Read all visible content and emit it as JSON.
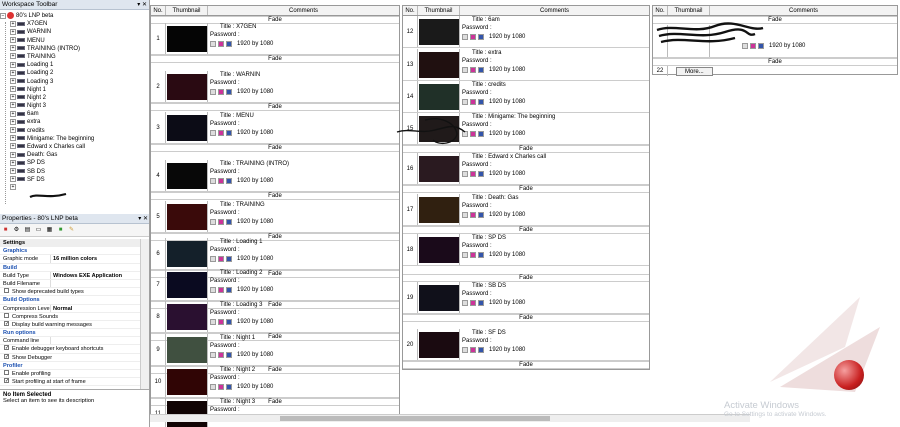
{
  "workspace": {
    "title": "Workspace Toolbar",
    "root": "80's LNP beta",
    "items": [
      "X7GEN",
      "WARNIN",
      "MENU",
      "TRAINING (INTRO)",
      "TRAINING",
      "Loading 1",
      "Loading 2",
      "Loading 3",
      "Night 1",
      "Night 2",
      "Night 3",
      "6am",
      "extra",
      "credits",
      "Minigame: The beginning",
      "Edward x Charles call",
      "Death: Gas",
      "SP DS",
      "SB DS",
      "SF DS"
    ]
  },
  "properties": {
    "title": "Properties - 80's LNP beta",
    "tab": "Settings",
    "sections": {
      "graphics": "Graphics",
      "build": "Build",
      "build_options": "Build Options",
      "run_options": "Run options",
      "profiler": "Profiler"
    },
    "graphic_mode_label": "Graphic mode",
    "graphic_mode_value": "16 million colors",
    "build_type_label": "Build Type",
    "build_type_value": "Windows EXE Application",
    "build_filename_label": "Build Filename",
    "show_deprecated": "Show deprecated build types",
    "compression_label": "Compression Level",
    "compression_value": "Normal",
    "compress_sounds": "Compress Sounds",
    "display_warnings": "Display build warning messages",
    "command_line": "Command line",
    "enable_debugger_shortcuts": "Enable debugger keyboard shortcuts",
    "show_debugger": "Show Debugger",
    "enable_profiling": "Enable profiling",
    "start_profiling": "Start profiling at start of frame"
  },
  "description": {
    "title": "No Item Selected",
    "text": "Select an item to see its description"
  },
  "frames_header": {
    "no": "No.",
    "thumbnail": "Thumbnail",
    "comments": "Comments"
  },
  "frames": [
    {
      "no": "1",
      "title": "Title : X7GEN"
    },
    {
      "no": "2",
      "title": "Title : WARNIN"
    },
    {
      "no": "3",
      "title": "Title : MENU"
    },
    {
      "no": "4",
      "title": "Title : TRAINING (INTRO)"
    },
    {
      "no": "5",
      "title": "Title : TRAINING"
    },
    {
      "no": "6",
      "title": "Title : Loading 1"
    },
    {
      "no": "7",
      "title": "Title : Loading 2"
    },
    {
      "no": "8",
      "title": "Title : Loading 3"
    },
    {
      "no": "9",
      "title": "Title : Night 1"
    },
    {
      "no": "10",
      "title": "Title : Night 2"
    },
    {
      "no": "11",
      "title": "Title : Night 3"
    },
    {
      "no": "12",
      "title": "Title : 6am"
    },
    {
      "no": "13",
      "title": "Title : extra"
    },
    {
      "no": "14",
      "title": "Title : credits"
    },
    {
      "no": "15",
      "title": "Title : Minigame: The beginning"
    },
    {
      "no": "16",
      "title": "Title : Edward x Charles call"
    },
    {
      "no": "17",
      "title": "Title : Death: Gas"
    },
    {
      "no": "18",
      "title": "Title : SP DS"
    },
    {
      "no": "19",
      "title": "Title : SB DS"
    },
    {
      "no": "20",
      "title": "Title : SF DS"
    }
  ],
  "password_label": "Password :",
  "resolution": "1920 by 1080",
  "fade_label": "Fade",
  "frame22": {
    "no": "22",
    "more": "More..."
  },
  "watermark": {
    "line1": "Activate Windows",
    "line2": "Go to Settings to activate Windows."
  }
}
